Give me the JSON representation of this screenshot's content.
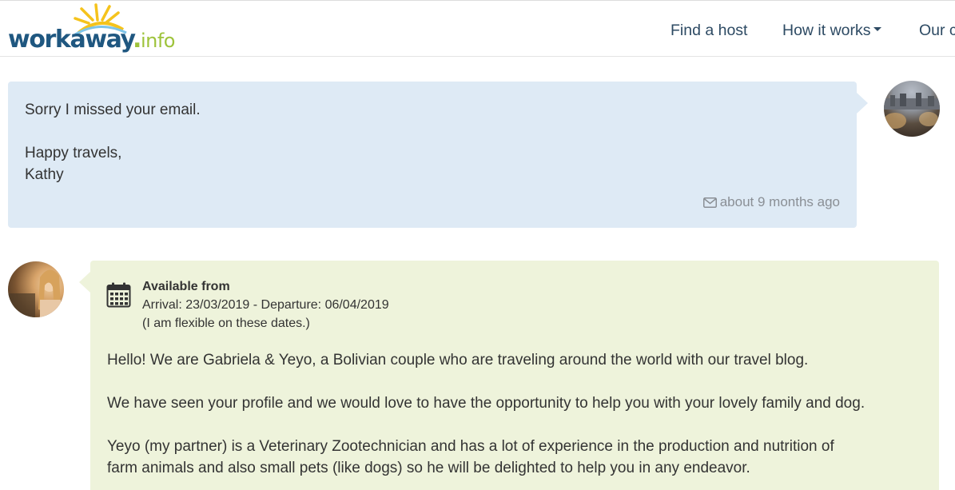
{
  "header": {
    "logo": {
      "word": "workaway",
      "dot": ".",
      "info": "info"
    },
    "nav": {
      "find_host": "Find a host",
      "how_it_works": "How it works",
      "our": "Our c"
    }
  },
  "messages": [
    {
      "lines": [
        "Sorry I missed your email.",
        "",
        "Happy travels,",
        "Kathy"
      ],
      "meta_icon": "envelope-icon",
      "timestamp": "about 9 months ago"
    },
    {
      "availability": {
        "icon": "calendar-icon",
        "title": "Available from",
        "dates": "Arrival: 23/03/2019 - Departure: 06/04/2019",
        "note": "(I am flexible on these dates.)"
      },
      "lines": [
        "Hello! We are Gabriela & Yeyo, a Bolivian couple who are traveling around the world with our travel blog.",
        "",
        "We have seen your profile and we would love to have the opportunity to help you with your lovely family and dog.",
        "",
        "Yeyo (my partner) is a Veterinary Zootechnician and has a lot of experience in the production and nutrition of",
        "farm animals and also small pets (like dogs) so he will be delighted to help you in any endeavor."
      ]
    }
  ],
  "colors": {
    "brand_blue": "#1f5780",
    "brand_green": "#9ec33b",
    "sun_yellow": "#f5c31c",
    "bubble_blue": "#deeaf5",
    "bubble_green": "#eef3db",
    "nav_text": "#2d4a63"
  }
}
